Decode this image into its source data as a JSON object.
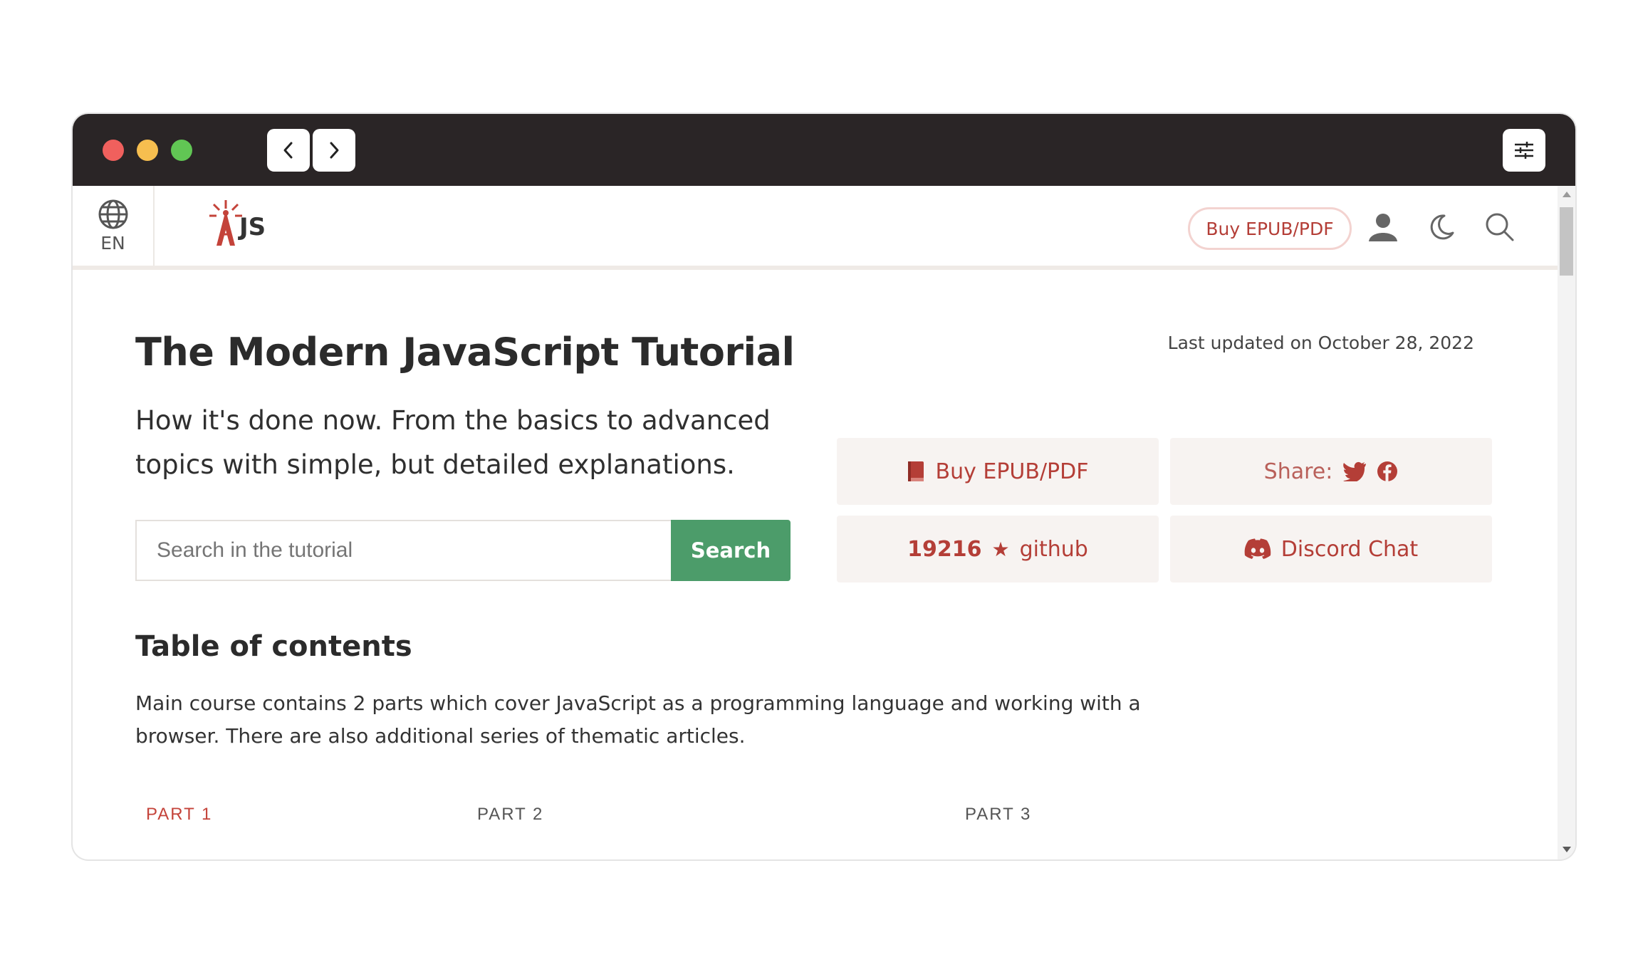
{
  "header": {
    "lang_label": "EN",
    "logo_text": "JS",
    "buy_label": "Buy EPUB/PDF"
  },
  "main": {
    "title": "The Modern JavaScript Tutorial",
    "updated": "Last updated on October 28, 2022",
    "lead_line1": "How it's done now. From the basics to advanced",
    "lead_line2": "topics with simple, but detailed explanations.",
    "search": {
      "placeholder": "Search in the tutorial",
      "button": "Search"
    },
    "cards": {
      "buy": "Buy EPUB/PDF",
      "share": "Share:",
      "github_count": "19216",
      "github_label": "github",
      "discord": "Discord Chat"
    },
    "toc_title": "Table of contents",
    "toc_desc_line1": "Main course contains 2 parts which cover JavaScript as a programming language and working with a",
    "toc_desc_line2": "browser. There are also additional series of thematic articles.",
    "parts": [
      "PART 1",
      "PART 2",
      "PART 3"
    ]
  },
  "colors": {
    "accent": "#b43e37",
    "search_button": "#4c9c6a",
    "titlebar": "#2a2526"
  }
}
